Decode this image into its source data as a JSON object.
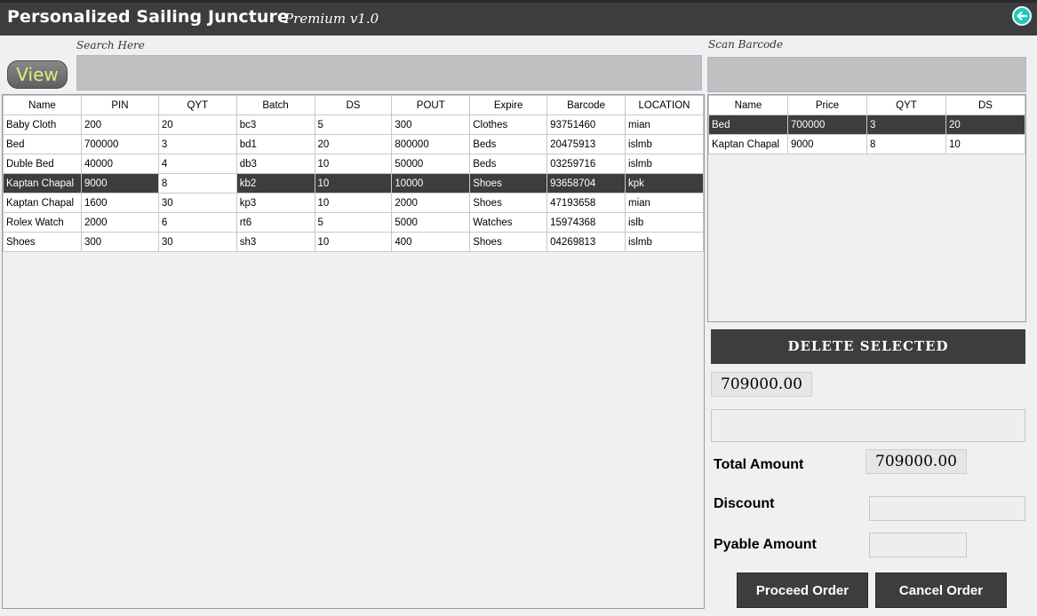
{
  "window": {
    "title": "Personalized Sailing Juncture",
    "version": "Premium v1.0",
    "back_icon": "arrow-left-circle-icon",
    "accent_color": "#22c8b8",
    "dark_color": "#3d3d3d"
  },
  "search": {
    "label": "Search Here",
    "view_label": "View",
    "value": ""
  },
  "barcode": {
    "label": "Scan Barcode",
    "value": ""
  },
  "products": {
    "columns": [
      "Name",
      "PIN",
      "QYT",
      "Batch",
      "DS",
      "POUT",
      "Expire",
      "Barcode",
      "LOCATION"
    ],
    "rows": [
      [
        "Baby Cloth",
        "200",
        "20",
        "bc3",
        "5",
        "300",
        "Clothes",
        "93751460",
        "mian"
      ],
      [
        "Bed",
        "700000",
        "3",
        "bd1",
        "20",
        "800000",
        "Beds",
        "20475913",
        "islmb"
      ],
      [
        "Duble Bed",
        "40000",
        "4",
        "db3",
        "10",
        "50000",
        "Beds",
        "03259716",
        "islmb"
      ],
      [
        "Kaptan Chapal",
        "9000",
        "8",
        "kb2",
        "10",
        "10000",
        "Shoes",
        "93658704",
        "kpk"
      ],
      [
        "Kaptan Chapal",
        "1600",
        "30",
        "kp3",
        "10",
        "2000",
        "Shoes",
        "47193658",
        "mian"
      ],
      [
        "Rolex Watch",
        "2000",
        "6",
        "rt6",
        "5",
        "5000",
        "Watches",
        "15974368",
        "islb"
      ],
      [
        "Shoes",
        "300",
        "30",
        "sh3",
        "10",
        "400",
        "Shoes",
        "04269813",
        "islmb"
      ]
    ],
    "selected_row": 3
  },
  "cart": {
    "columns": [
      "Name",
      "Price",
      "QYT",
      "DS"
    ],
    "rows": [
      [
        "Bed",
        "700000",
        "3",
        "20"
      ],
      [
        "Kaptan Chapal",
        "9000",
        "8",
        "10"
      ]
    ],
    "selected_row": 0
  },
  "delete_label": "DELETE SELECTED",
  "subtotal": "709000.00",
  "note_value": "",
  "totals": {
    "total_label": "Total Amount",
    "total_value": "709000.00",
    "discount_label": "Discount",
    "discount_value": "",
    "payable_label": "Pyable Amount",
    "payable_value": ""
  },
  "actions": {
    "proceed": "Proceed Order",
    "cancel": "Cancel Order"
  }
}
